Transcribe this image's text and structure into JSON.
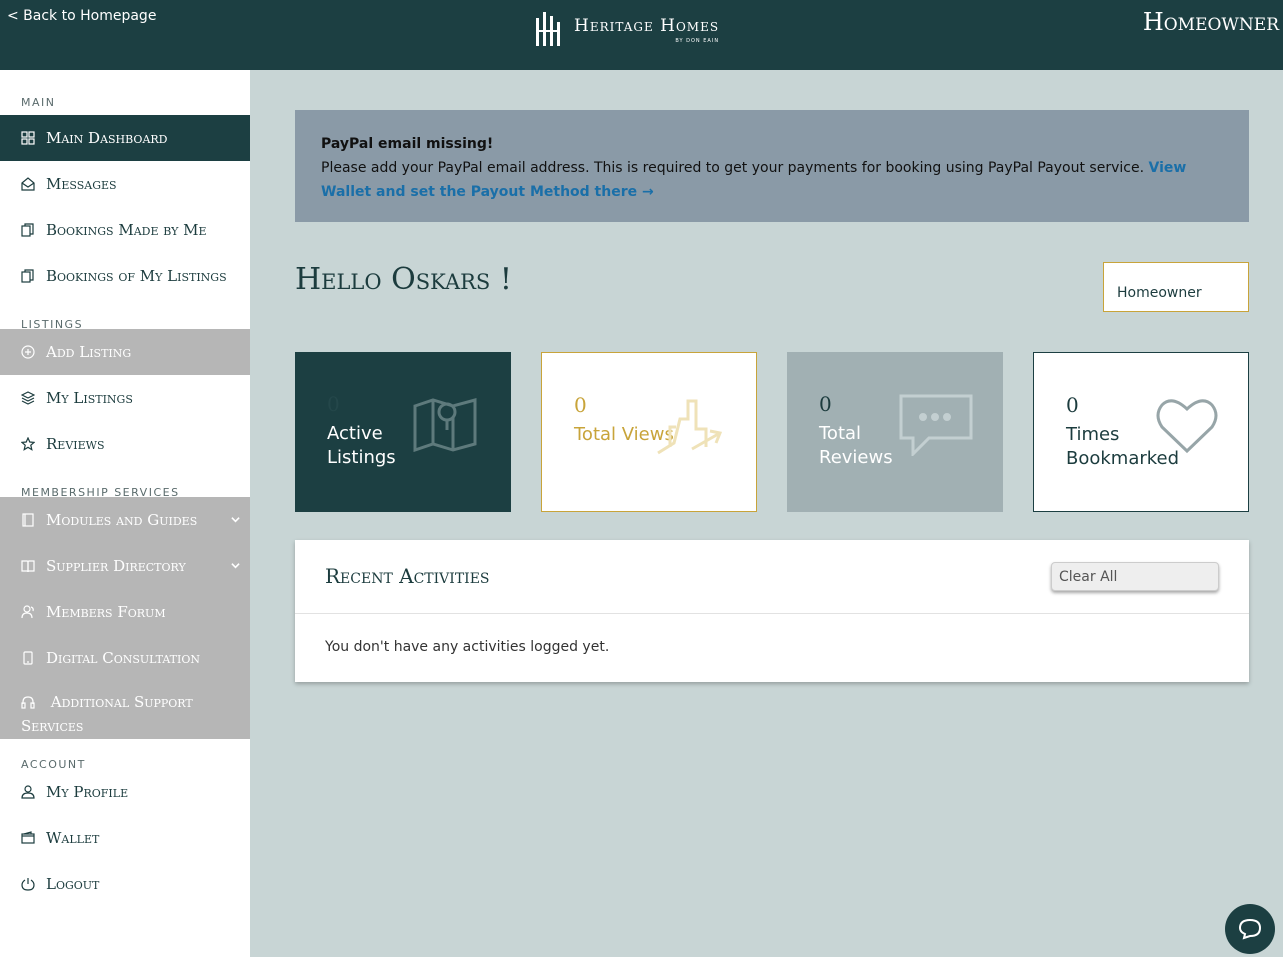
{
  "header": {
    "back_link": "< Back to Homepage",
    "logo_title": "Heritage Homes",
    "logo_sub": "BY DON EAIN",
    "role_title": "Homeowner"
  },
  "sidebar": {
    "sections": {
      "main": "MAIN",
      "listings": "LISTINGS",
      "membership": "MEMBERSHIP SERVICES",
      "account": "ACCOUNT"
    },
    "items": {
      "main_dashboard": "Main Dashboard",
      "messages": "Messages",
      "bookings_by_me": "Bookings Made by Me",
      "bookings_of_listings": "Bookings of My Listings",
      "add_listing": "Add Listing",
      "my_listings": "My Listings",
      "reviews": "Reviews",
      "modules_guides": "Modules and Guides",
      "supplier_directory": "Supplier Directory",
      "members_forum": "Members Forum",
      "digital_consultation": "Digital Consultation",
      "additional_support": "Additional Support Services",
      "my_profile": "My Profile",
      "wallet": "Wallet",
      "logout": "Logout"
    }
  },
  "alert": {
    "title": "PayPal email missing!",
    "message": "Please add your PayPal email address. This is required to get your payments for booking using PayPal Payout service.",
    "link": "View Wallet and set the Payout Method there →"
  },
  "greeting": "Hello Oskars !",
  "role_box": "Homeowner",
  "stats": [
    {
      "value": "0",
      "label": "Active Listings"
    },
    {
      "value": "0",
      "label": "Total Views"
    },
    {
      "value": "0",
      "label": "Total Reviews"
    },
    {
      "value": "0",
      "label": "Times Bookmarked"
    }
  ],
  "activities": {
    "title": "Recent Activities",
    "clear_button": "Clear All",
    "empty_text": "You don't have any activities logged yet."
  },
  "colors": {
    "primary": "#1c3f42",
    "gold": "#c8a43a",
    "background": "#c8d5d5",
    "alert_bg": "#8a9aa7"
  }
}
